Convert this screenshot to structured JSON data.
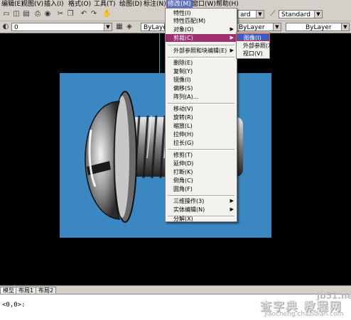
{
  "menubar": {
    "items": [
      {
        "label": "编辑(E)"
      },
      {
        "label": "视图(V)"
      },
      {
        "label": "插入(I)"
      },
      {
        "label": "格式(O)"
      },
      {
        "label": "工具(T)"
      },
      {
        "label": "绘图(D)"
      },
      {
        "label": "标注(N)"
      },
      {
        "label": "修改(M)"
      },
      {
        "label": "窗口(W)"
      },
      {
        "label": "帮助(H)"
      }
    ]
  },
  "toolbar": {
    "textstyle_combo": "ard",
    "dimstyle_combo": "Standard",
    "layer_combo": "0",
    "color_combo": "ByLayer",
    "linetype_combo": "ByLayer",
    "lineweight_combo": "ByLayer",
    "plotstyle_combo": "ByLayer"
  },
  "modify_menu": {
    "items": [
      {
        "label": "特性(I)"
      },
      {
        "label": "特性匹配(M)"
      },
      {
        "label": "对象(O)",
        "submenu": true
      },
      {
        "label": "剪裁(C)",
        "submenu": true,
        "highlighted": true
      },
      {
        "label": "外部参照和块编辑(E)",
        "submenu": true
      },
      {
        "label": "删除(E)"
      },
      {
        "label": "复制(Y)"
      },
      {
        "label": "镜像(I)"
      },
      {
        "label": "偏移(S)"
      },
      {
        "label": "阵列(A)..."
      },
      {
        "label": "移动(V)"
      },
      {
        "label": "旋转(R)"
      },
      {
        "label": "缩放(L)"
      },
      {
        "label": "拉伸(H)"
      },
      {
        "label": "拉长(G)"
      },
      {
        "label": "修剪(T)"
      },
      {
        "label": "延伸(D)"
      },
      {
        "label": "打断(K)"
      },
      {
        "label": "倒角(C)"
      },
      {
        "label": "圆角(F)"
      },
      {
        "label": "三维操作(3)",
        "submenu": true
      },
      {
        "label": "实体编辑(N)",
        "submenu": true
      },
      {
        "label": "分解(X)"
      }
    ]
  },
  "clip_submenu": {
    "items": [
      {
        "label": "图像(I)",
        "highlighted": true
      },
      {
        "label": "外部参照(X)"
      },
      {
        "label": "视口(V)"
      }
    ]
  },
  "layout_tabs": [
    {
      "label": "模型",
      "active": true
    },
    {
      "label": "布局1"
    },
    {
      "label": "布局2"
    }
  ],
  "command_line": {
    "text": "<0,0>:"
  },
  "watermark": {
    "site": "jb51.net",
    "brand": "查字典 教程网",
    "url": "jiaocheng.chazidian.com"
  },
  "colors": {
    "viewport_bg": "#3a87c2",
    "menu_highlight": "#9c2f6e",
    "submenu_highlight": "#3a5ec8"
  }
}
